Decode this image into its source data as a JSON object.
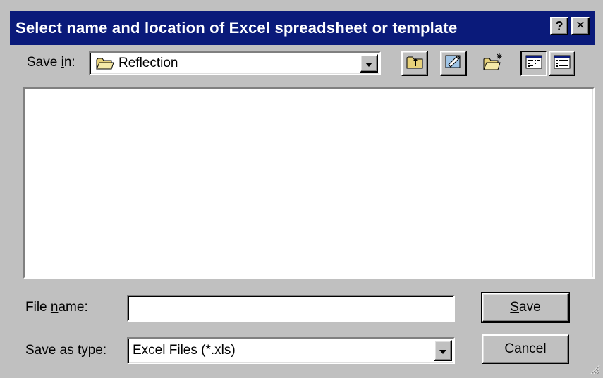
{
  "dialog": {
    "title": "Select name and location of Excel spreadsheet or template",
    "help_glyph": "?",
    "close_glyph": "✕"
  },
  "save_in": {
    "label_prefix": "Save ",
    "label_access": "i",
    "label_suffix": "n:",
    "value": "Reflection",
    "icons": [
      "folder-icon",
      "up-one-level-icon",
      "desktop-icon",
      "new-folder-icon",
      "list-view-icon",
      "details-view-icon"
    ]
  },
  "file_name": {
    "label_prefix": "File ",
    "label_access": "n",
    "label_suffix": "ame:",
    "value": ""
  },
  "save_as_type": {
    "label_prefix": "Save as ",
    "label_access": "t",
    "label_suffix": "ype:",
    "value": "Excel Files (*.xls)"
  },
  "buttons": {
    "save_access": "S",
    "save_rest": "ave",
    "cancel": "Cancel"
  },
  "colors": {
    "titlebar": "#0a1a7a",
    "face": "#c0c0c0"
  }
}
